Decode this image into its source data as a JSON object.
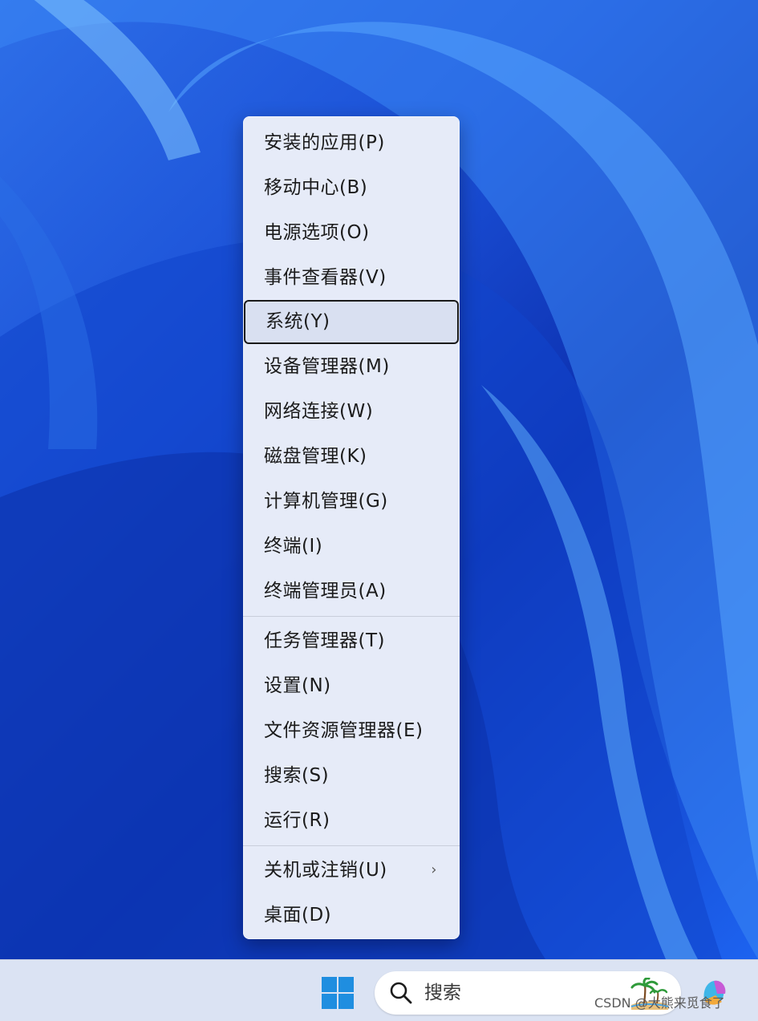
{
  "context_menu": {
    "items": [
      {
        "label": "安装的应用(P)"
      },
      {
        "label": "移动中心(B)"
      },
      {
        "label": "电源选项(O)"
      },
      {
        "label": "事件查看器(V)"
      },
      {
        "label": "系统(Y)",
        "focused": true
      },
      {
        "label": "设备管理器(M)"
      },
      {
        "label": "网络连接(W)"
      },
      {
        "label": "磁盘管理(K)"
      },
      {
        "label": "计算机管理(G)"
      },
      {
        "label": "终端(I)"
      },
      {
        "label": "终端管理员(A)"
      },
      {
        "label": "任务管理器(T)"
      },
      {
        "label": "设置(N)"
      },
      {
        "label": "文件资源管理器(E)"
      },
      {
        "label": "搜索(S)"
      },
      {
        "label": "运行(R)"
      },
      {
        "label": "关机或注销(U)",
        "has_submenu": true
      },
      {
        "label": "桌面(D)"
      }
    ],
    "submenu_icon": "chevron-right-icon"
  },
  "taskbar": {
    "start_icon": "windows-logo-icon",
    "search": {
      "label": "搜索",
      "icon": "search-icon"
    },
    "copilot_icon": "copilot-icon",
    "watermark": "CSDN @大熊来觅食了"
  },
  "colors": {
    "accent": "#1f8ee0",
    "menu_bg": "#e6ebf8",
    "taskbar_bg": "#dbe3f3",
    "wallpaper": "#1a4fd6"
  }
}
